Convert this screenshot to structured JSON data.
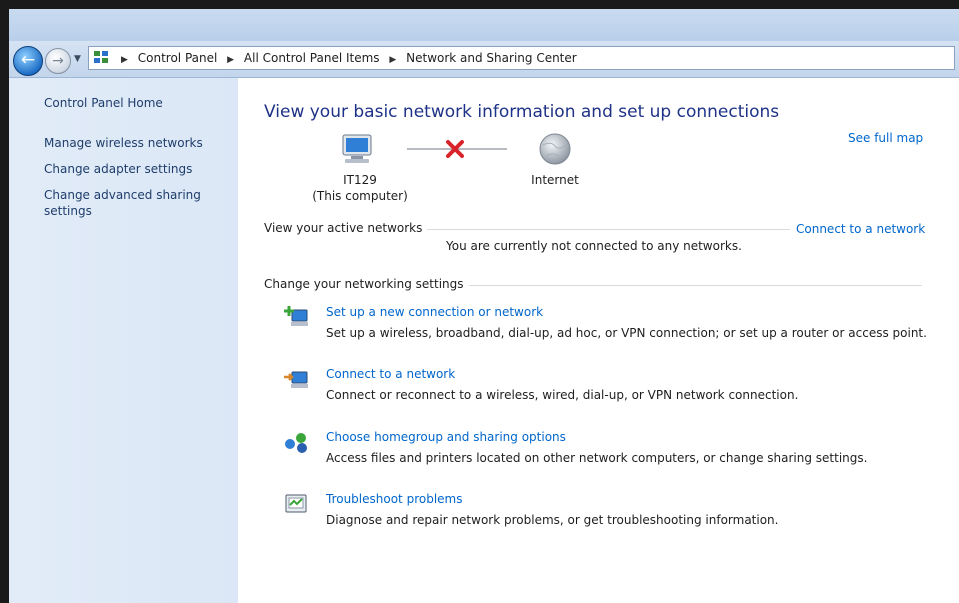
{
  "breadcrumbs": [
    "Control Panel",
    "All Control Panel Items",
    "Network and Sharing Center"
  ],
  "sidebar": {
    "home": "Control Panel Home",
    "links": [
      "Manage wireless networks",
      "Change adapter settings",
      "Change advanced sharing settings"
    ]
  },
  "main": {
    "title": "View your basic network information and set up connections",
    "see_full_map": "See full map",
    "computer_name": "IT129",
    "computer_sub": "(This computer)",
    "internet_label": "Internet",
    "active_networks_label": "View your active networks",
    "connect_link": "Connect to a network",
    "not_connected": "You are currently not connected to any networks.",
    "change_settings_label": "Change your networking settings",
    "tasks": [
      {
        "title": "Set up a new connection or network",
        "desc": "Set up a wireless, broadband, dial-up, ad hoc, or VPN connection; or set up a router or access point.",
        "icon": "new-connection-icon"
      },
      {
        "title": "Connect to a network",
        "desc": "Connect or reconnect to a wireless, wired, dial-up, or VPN network connection.",
        "icon": "connect-network-icon"
      },
      {
        "title": "Choose homegroup and sharing options",
        "desc": "Access files and printers located on other network computers, or change sharing settings.",
        "icon": "homegroup-icon"
      },
      {
        "title": "Troubleshoot problems",
        "desc": "Diagnose and repair network problems, or get troubleshooting information.",
        "icon": "troubleshoot-icon"
      }
    ]
  },
  "colors": {
    "link": "#0066cc",
    "title": "#1e3287",
    "sidebar": "#dbe7f6",
    "error_x": "#d8232a"
  }
}
